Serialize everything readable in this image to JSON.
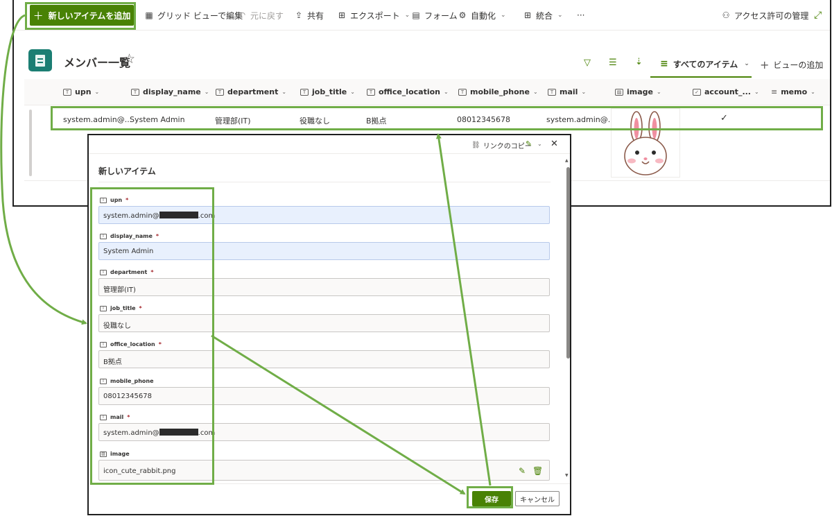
{
  "toolbar": {
    "new_item": "新しいアイテムを追加",
    "grid_edit": "グリッド ビューで編集",
    "undo": "元に戻す",
    "share": "共有",
    "export": "エクスポート",
    "form": "フォーム",
    "automate": "自動化",
    "integrate": "統合",
    "more": "···",
    "access": "アクセス許可の管理"
  },
  "list": {
    "title": "メンバー一覧",
    "view_name": "すべてのアイテム",
    "add_view": "ビューの追加"
  },
  "columns": [
    "upn",
    "display_name",
    "department",
    "job_title",
    "office_location",
    "mobile_phone",
    "mail",
    "image",
    "account_...",
    "memo"
  ],
  "row": {
    "upn": "system.admin@...",
    "display_name": "System Admin",
    "department": "管理部(IT)",
    "job_title": "役職なし",
    "office_location": "B拠点",
    "mobile_phone": "08012345678",
    "mail": "system.admin@...",
    "account_enabled": "✓"
  },
  "panel": {
    "copy_link": "リンクのコピー",
    "title": "新しいアイテム",
    "fields": [
      {
        "label": "upn",
        "required": "*",
        "value_prefix": "system.admin@",
        "value_suffix": ".com"
      },
      {
        "label": "display_name",
        "required": "*",
        "value": "System Admin"
      },
      {
        "label": "department",
        "required": "*",
        "value": "管理部(IT)"
      },
      {
        "label": "job_title",
        "required": "*",
        "value": "役職なし"
      },
      {
        "label": "office_location",
        "required": "*",
        "value": "B拠点"
      },
      {
        "label": "mobile_phone",
        "required": "",
        "value": "08012345678"
      },
      {
        "label": "mail",
        "required": "*",
        "value_prefix": "system.admin@",
        "value_suffix": ".com"
      },
      {
        "label": "image",
        "required": "",
        "value": "icon_cute_rabbit.png"
      }
    ],
    "save": "保存",
    "cancel": "キャンセル"
  },
  "colors": {
    "brand_green": "#498205",
    "highlight_green": "#70ad47",
    "filled_field_bg": "#e8f0fd",
    "required_red": "#a4262c"
  }
}
